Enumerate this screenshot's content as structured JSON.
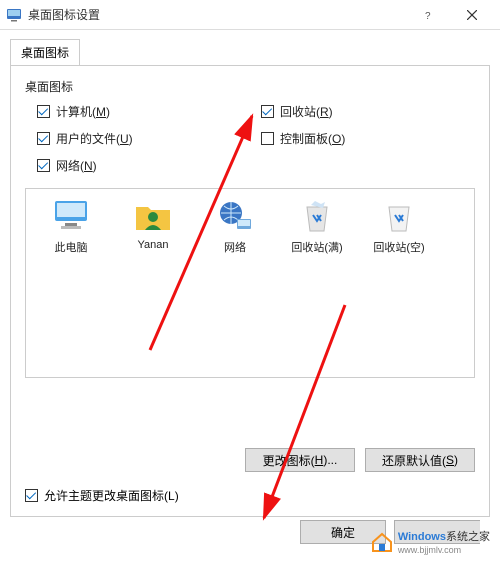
{
  "window": {
    "title": "桌面图标设置",
    "close_label": "关闭"
  },
  "tab": {
    "label": "桌面图标"
  },
  "group": {
    "label": "桌面图标"
  },
  "checks": {
    "computer": {
      "label_pre": "计算机(",
      "hotkey": "M",
      "label_post": ")",
      "checked": true
    },
    "recycle": {
      "label_pre": "回收站(",
      "hotkey": "R",
      "label_post": ")",
      "checked": true
    },
    "userfiles": {
      "label_pre": "用户的文件(",
      "hotkey": "U",
      "label_post": ")",
      "checked": true
    },
    "controlpanel": {
      "label_pre": "控制面板(",
      "hotkey": "O",
      "label_post": ")",
      "checked": false
    },
    "network": {
      "label_pre": "网络(",
      "hotkey": "N",
      "label_post": ")",
      "checked": true
    }
  },
  "icons": {
    "thispc": {
      "label": "此电脑"
    },
    "user": {
      "label": "Yanan"
    },
    "network": {
      "label": "网络"
    },
    "bin_full": {
      "label": "回收站(满)"
    },
    "bin_empty": {
      "label": "回收站(空)"
    }
  },
  "buttons": {
    "change_icon": {
      "pre": "更改图标(",
      "hot": "H",
      "post": ")..."
    },
    "restore": {
      "pre": "还原默认值(",
      "hot": "S",
      "post": ")"
    },
    "ok": "确定"
  },
  "allow_theme": {
    "pre": "允许主题更改桌面图标(",
    "hot": "L",
    "post": ")",
    "checked": true
  },
  "watermark": {
    "brand_a": "Windows",
    "brand_b": "系统之家",
    "url": "www.bjjmlv.com"
  }
}
